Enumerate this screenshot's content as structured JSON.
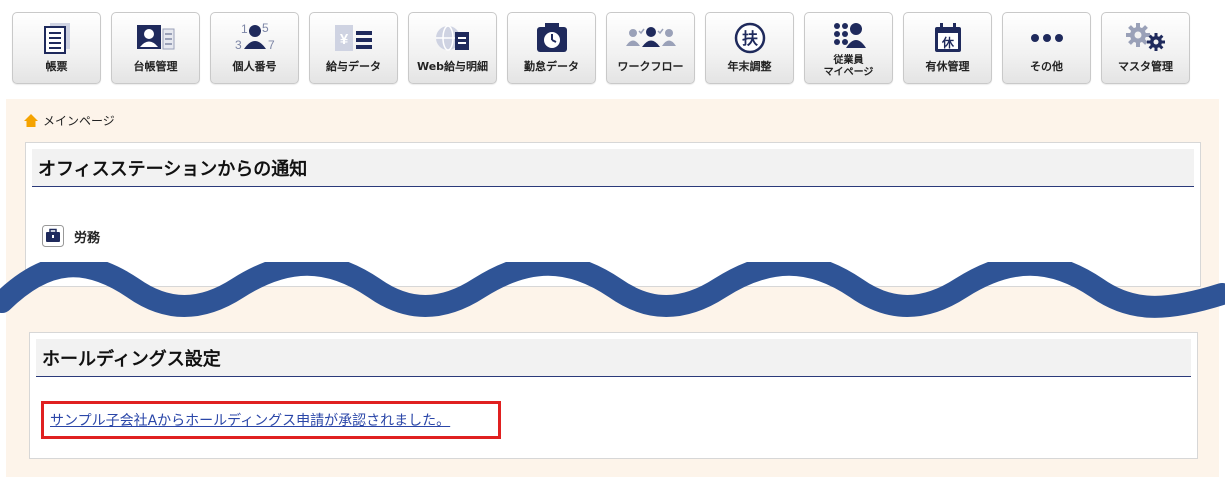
{
  "toolbar": {
    "items": [
      {
        "label": "帳票",
        "icon": "document-list-icon"
      },
      {
        "label": "台帳管理",
        "icon": "ledger-person-icon"
      },
      {
        "label": "個人番号",
        "icon": "personal-number-icon"
      },
      {
        "label": "給与データ",
        "icon": "salary-data-icon"
      },
      {
        "label": "Web給与明細",
        "icon": "web-payslip-icon"
      },
      {
        "label": "勤怠データ",
        "icon": "attendance-clock-icon"
      },
      {
        "label": "ワークフロー",
        "icon": "workflow-people-icon"
      },
      {
        "label": "年末調整",
        "icon": "year-end-adjustment-icon"
      },
      {
        "label": "従業員マイページ",
        "label_line1": "従業員",
        "label_line2": "マイページ",
        "icon": "employee-mypage-icon"
      },
      {
        "label": "有休管理",
        "icon": "paid-leave-calendar-icon"
      },
      {
        "label": "その他",
        "icon": "more-dots-icon"
      },
      {
        "label": "マスタ管理",
        "icon": "master-gears-icon"
      }
    ],
    "icon_glyphs": {
      "salary_yen": "¥",
      "year_end": "扶",
      "leave": "休",
      "num_1": "1",
      "num_3": "3",
      "num_5": "5",
      "num_7": "7"
    }
  },
  "breadcrumb": {
    "label": "メインページ",
    "icon": "home-icon"
  },
  "notifications_panel": {
    "title": "オフィスステーションからの通知",
    "category": {
      "label": "労務",
      "icon": "briefcase-icon"
    }
  },
  "holdings_panel": {
    "title": "ホールディングス設定",
    "notice_link": "サンプル子会社Aからホールディングス申請が承認されました。"
  },
  "colors": {
    "accent_navy": "#2b3a7a",
    "wave_blue": "#2f5496",
    "highlight_red": "#e02020",
    "link_blue": "#2a46a8",
    "main_bg": "#fdf4ea",
    "icon_navy": "#1f2a5c"
  }
}
